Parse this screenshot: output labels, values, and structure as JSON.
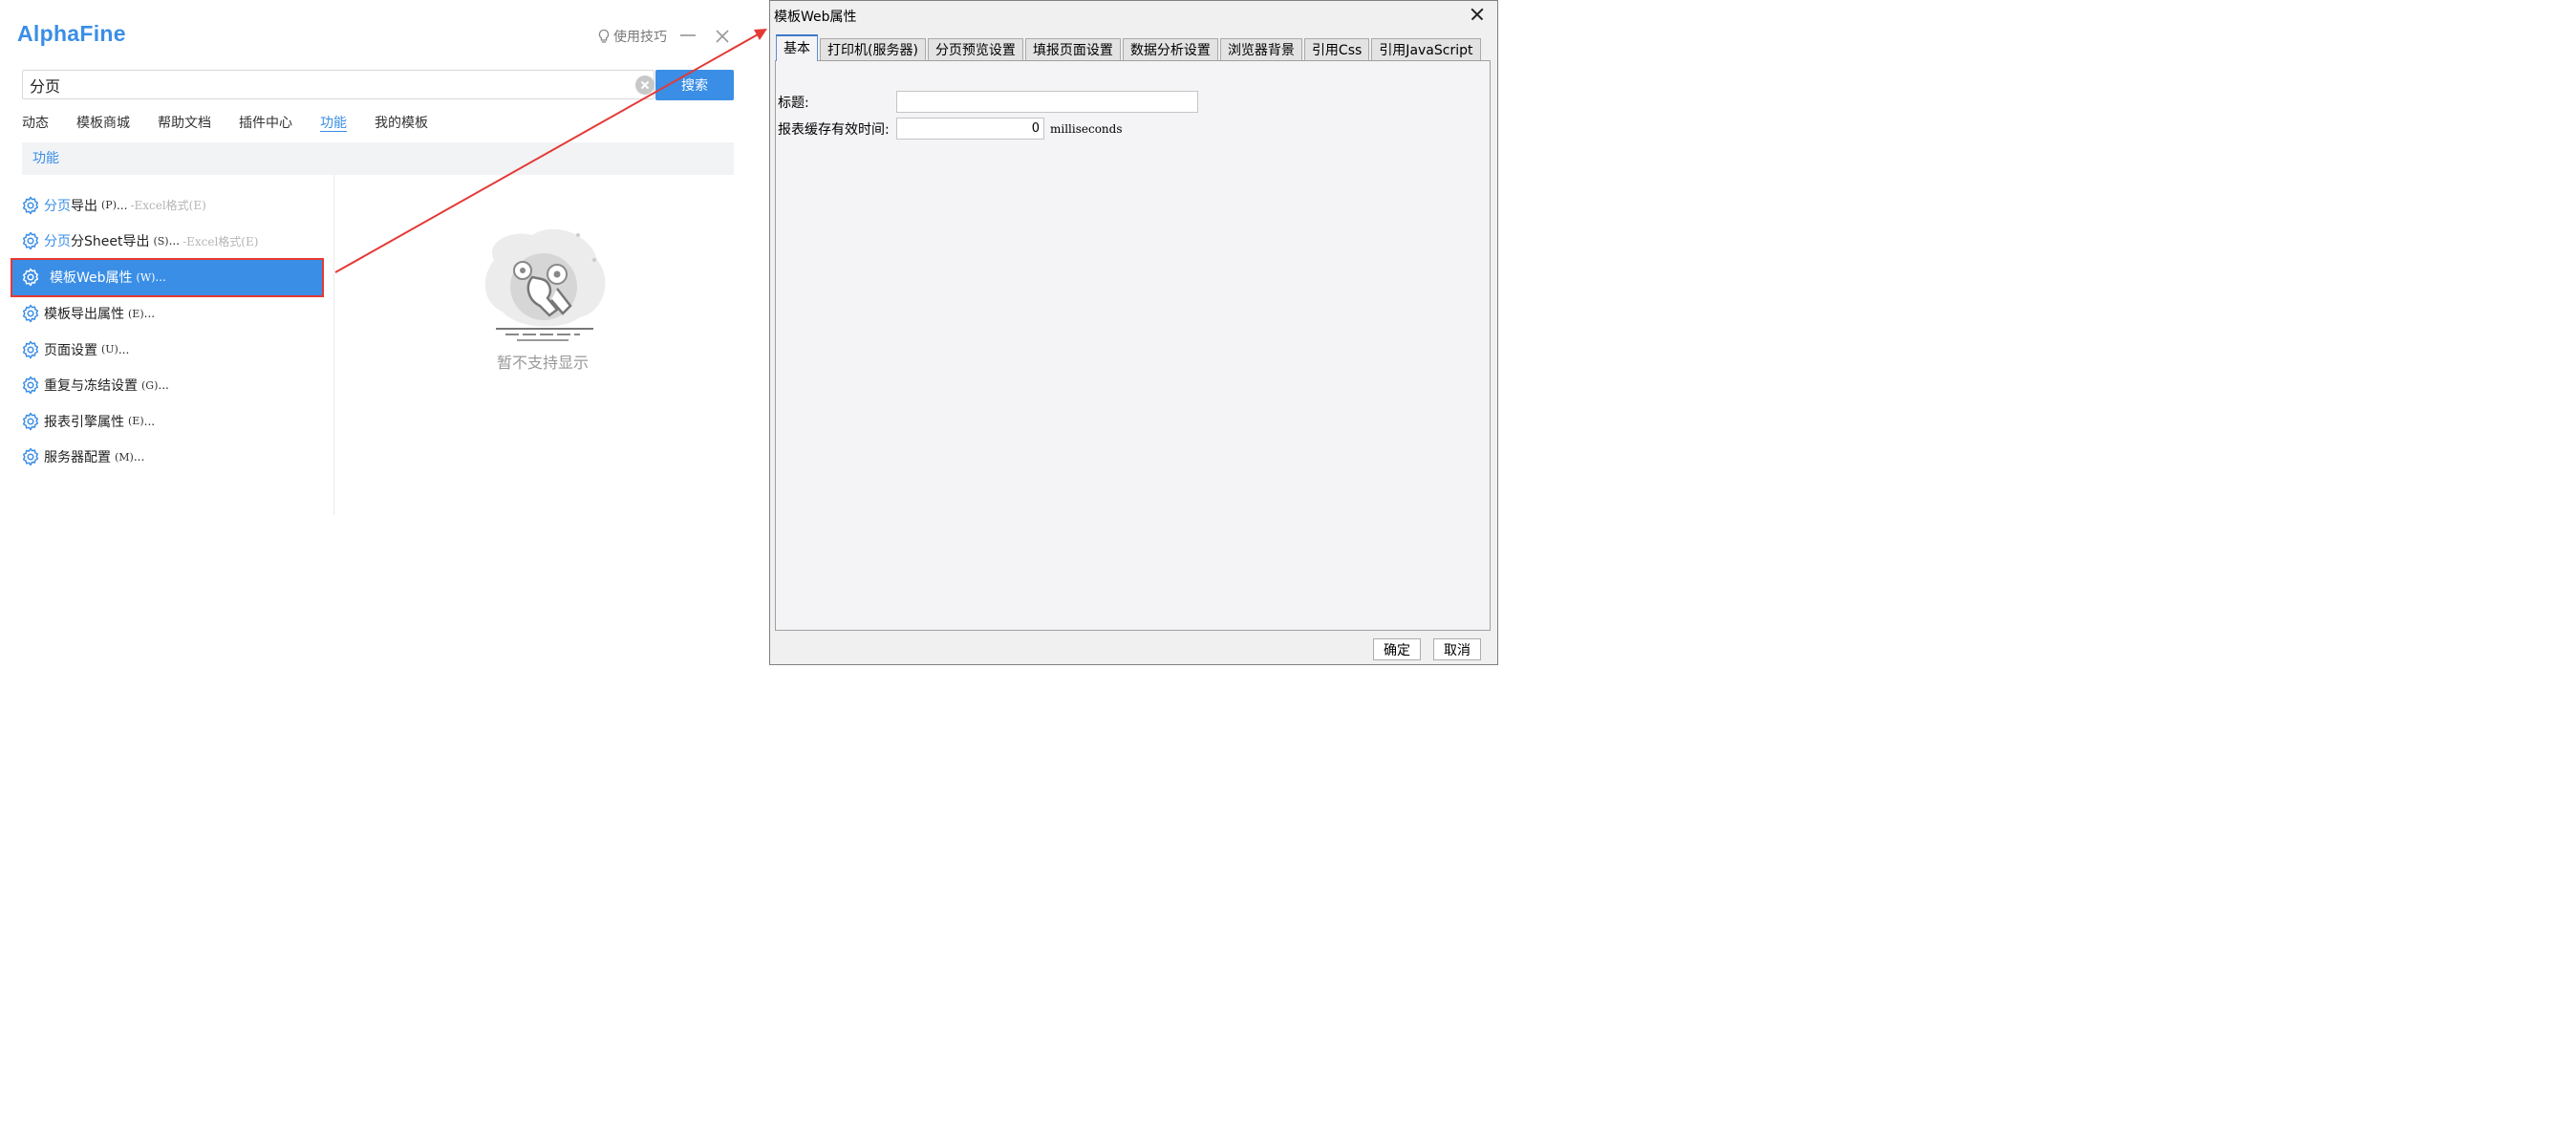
{
  "alphafine": {
    "logo": "AlphaFine",
    "tips_label": "使用技巧",
    "search": {
      "value": "分页",
      "button_label": "搜索"
    },
    "tabs": [
      {
        "label": "动态"
      },
      {
        "label": "模板商城"
      },
      {
        "label": "帮助文档"
      },
      {
        "label": "插件中心"
      },
      {
        "label": "功能",
        "active": true
      },
      {
        "label": "我的模板"
      }
    ],
    "section_title": "功能",
    "results": [
      {
        "highlight": "分页",
        "text": "导出",
        "key": "(P)",
        "dots": "...",
        "extra": "-Excel格式(E)"
      },
      {
        "highlight": "分页",
        "text": "分Sheet导出",
        "key": "(S)",
        "dots": "...",
        "extra": "-Excel格式(E)"
      },
      {
        "highlight": "",
        "text": "模板Web属性",
        "key": "(W)",
        "dots": "...",
        "extra": "",
        "selected": true
      },
      {
        "highlight": "",
        "text": "模板导出属性",
        "key": "(E)",
        "dots": "...",
        "extra": ""
      },
      {
        "highlight": "",
        "text": "页面设置",
        "key": "(U)",
        "dots": "...",
        "extra": ""
      },
      {
        "highlight": "",
        "text": "重复与冻结设置",
        "key": "(G)",
        "dots": "...",
        "extra": ""
      },
      {
        "highlight": "",
        "text": "报表引擎属性",
        "key": "(E)",
        "dots": "...",
        "extra": ""
      },
      {
        "highlight": "",
        "text": "服务器配置",
        "key": "(M)",
        "dots": "...",
        "extra": ""
      }
    ],
    "empty_text": "暂不支持显示",
    "accent_color": "#3a8ee6",
    "annotation_color": "#e53935"
  },
  "dialog": {
    "title": "模板Web属性",
    "tabs": [
      {
        "label": "基本",
        "active": true
      },
      {
        "label": "打印机(服务器)"
      },
      {
        "label": "分页预览设置"
      },
      {
        "label": "填报页面设置"
      },
      {
        "label": "数据分析设置"
      },
      {
        "label": "浏览器背景"
      },
      {
        "label": "引用Css"
      },
      {
        "label": "引用JavaScript"
      }
    ],
    "fields": {
      "title_label": "标题:",
      "title_value": "",
      "cache_label": "报表缓存有效时间:",
      "cache_value": "0",
      "cache_unit": "milliseconds"
    },
    "ok_label": "确定",
    "cancel_label": "取消"
  }
}
